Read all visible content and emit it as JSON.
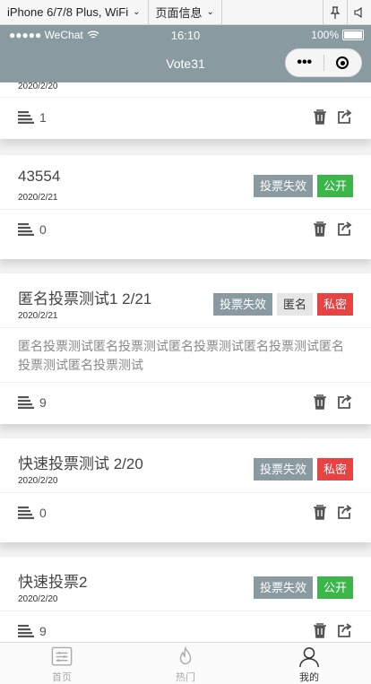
{
  "devtools": {
    "device": "iPhone 6/7/8 Plus, WiFi",
    "page_info": "页面信息"
  },
  "status": {
    "carrier": "●●●●● WeChat",
    "time": "16:10",
    "battery": "100%"
  },
  "nav": {
    "title": "Vote31",
    "menu_dots": "•••"
  },
  "partial_top": {
    "date": "2020/2/20",
    "count": "1"
  },
  "cards": [
    {
      "title": "43554",
      "date": "2020/2/21",
      "tags": [
        "投票失效",
        "公开"
      ],
      "count": "0"
    },
    {
      "title": "匿名投票测试1 2/21",
      "date": "2020/2/21",
      "tags": [
        "投票失效",
        "匿名",
        "私密"
      ],
      "desc": "匿名投票测试匿名投票测试匿名投票测试匿名投票测试匿名投票测试匿名投票测试",
      "count": "9"
    },
    {
      "title": "快速投票测试 2/20",
      "date": "2020/2/20",
      "tags": [
        "投票失效",
        "私密"
      ],
      "count": "0"
    },
    {
      "title": "快速投票2",
      "date": "2020/2/20",
      "tags": [
        "投票失效",
        "公开"
      ],
      "count": "9"
    }
  ],
  "tabbar": {
    "home": "首页",
    "hot": "热门",
    "mine": "我的"
  },
  "colors": {
    "nav_bg": "#8a9aa1",
    "expired_tag": "#8a9aa1",
    "public_tag": "#3cb54a",
    "private_tag": "#e74343",
    "anon_tag": "#e6e6e6"
  }
}
